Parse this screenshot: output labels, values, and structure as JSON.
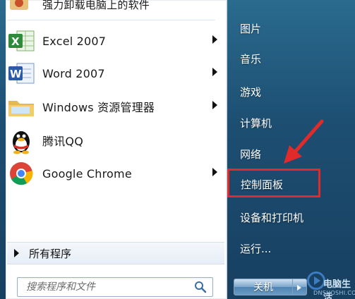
{
  "left_menu": {
    "top_partial": {
      "label": "强力卸载电脑上的软件",
      "icon": "uninstall-icon"
    },
    "items": [
      {
        "label": "Excel 2007",
        "icon": "excel-icon",
        "has_submenu": true
      },
      {
        "label": "Word 2007",
        "icon": "word-icon",
        "has_submenu": true
      },
      {
        "label": "Windows 资源管理器",
        "icon": "explorer-folder-icon",
        "has_submenu": true
      },
      {
        "label": "腾讯QQ",
        "icon": "qq-penguin-icon",
        "has_submenu": false
      },
      {
        "label": "Google Chrome",
        "icon": "chrome-icon",
        "has_submenu": true
      }
    ],
    "all_programs_label": "所有程序",
    "search_placeholder": "搜索程序和文件"
  },
  "right_menu": {
    "items": [
      {
        "label": "图片"
      },
      {
        "label": "音乐"
      },
      {
        "label": "游戏"
      },
      {
        "label": "计算机"
      },
      {
        "label": "网络"
      },
      {
        "label": "控制面板",
        "highlighted": true
      },
      {
        "label": "设备和打印机"
      },
      {
        "label": "运行..."
      }
    ],
    "shutdown_label": "关机"
  },
  "watermark": {
    "text": "电脑生活",
    "sub": "DNSHOSHI.COM"
  },
  "colors": {
    "highlight_border": "#e12a2a",
    "arrow": "#e12a2a",
    "pane_bg": "#ffffff"
  }
}
